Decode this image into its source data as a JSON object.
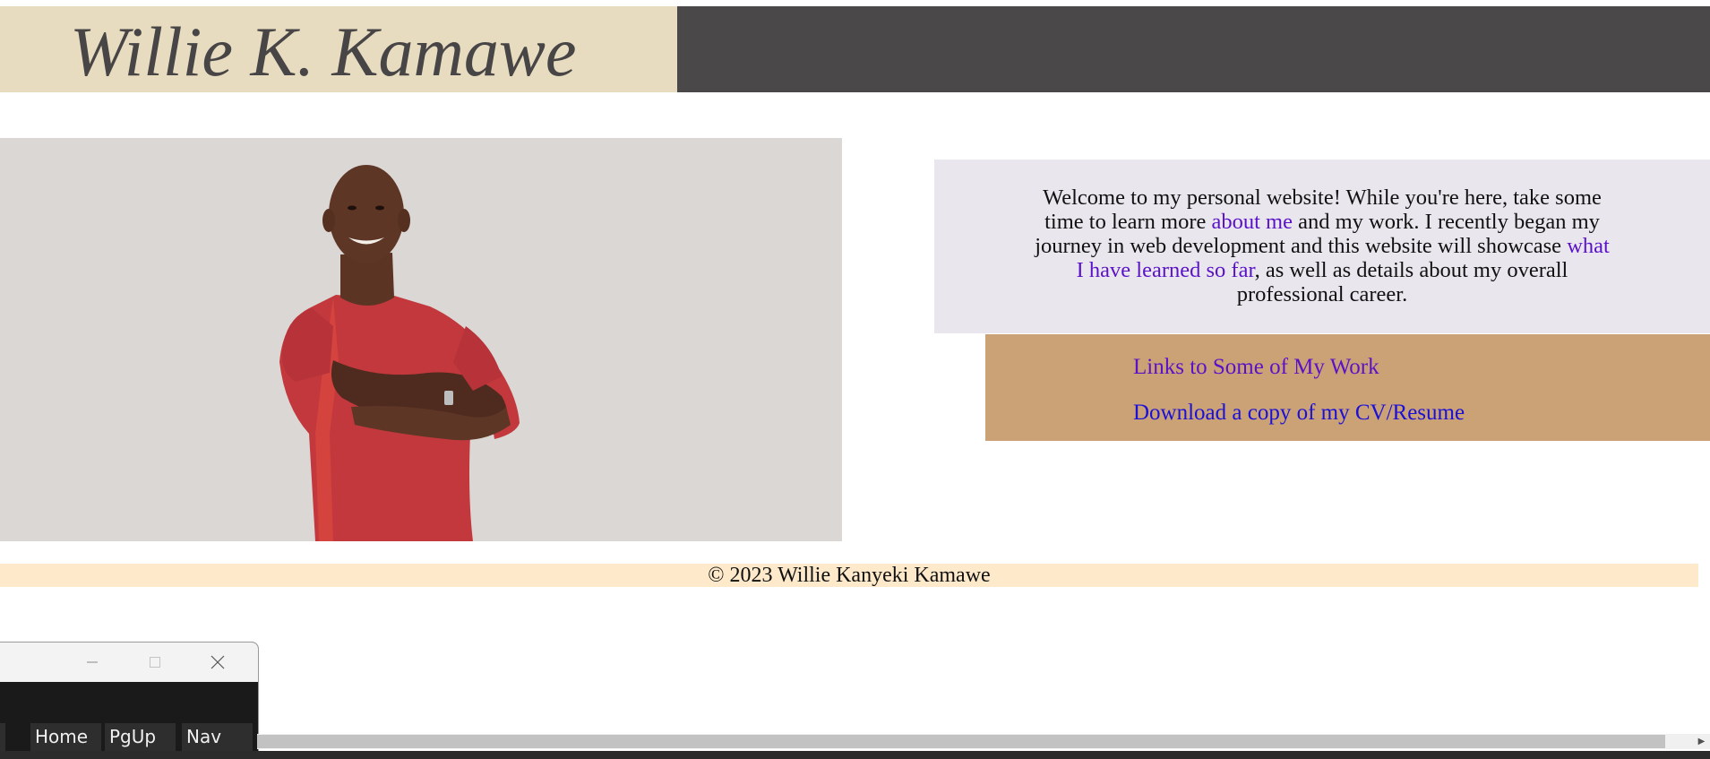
{
  "header": {
    "title": "Willie K. Kamawe",
    "left_color": "#e8dcc0",
    "right_color": "#4a4849"
  },
  "hero": {
    "photo_icon": "portrait-photo"
  },
  "welcome": {
    "part1": "Welcome to my personal website! While you're here, take some time to learn more ",
    "link_about": "about me",
    "part2": " and my work. I recently began my journey in web development and this website will showcase ",
    "link_learned": "what I have learned so far",
    "part3": ", as well as details about my overall professional career."
  },
  "links": {
    "work": "Links to Some of My Work",
    "cv": "Download a copy of my CV/Resume"
  },
  "footer": {
    "text": "© 2023 Willie Kanyeki Kamawe"
  },
  "mini_window": {
    "keys": [
      "Home",
      "PgUp",
      "Nav"
    ],
    "minimize_icon": "minimize-icon",
    "maximize_icon": "maximize-icon",
    "close_icon": "close-icon"
  },
  "colors": {
    "link_visited": "#5a12c8",
    "link_unvisited": "#1a10d8",
    "footer_bg": "#feeaca",
    "links_bg": "#cba176",
    "welcome_bg": "#e9e6ed"
  }
}
